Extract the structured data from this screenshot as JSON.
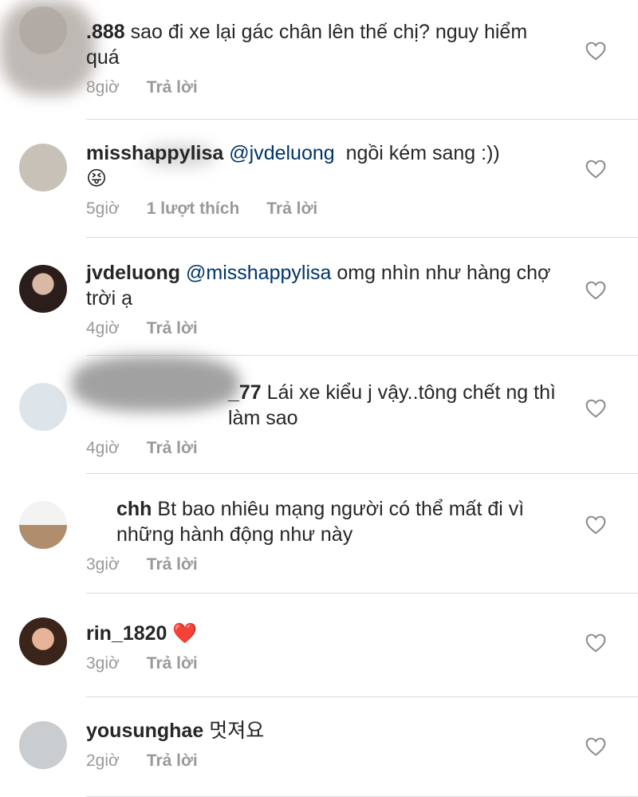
{
  "comments": [
    {
      "username": ".888",
      "text": "sao đi xe lại gác chân lên thế chị? nguy hiểm quá",
      "time": "8giờ",
      "reply": "Trả lời"
    },
    {
      "username": "misshappylisa",
      "mention": "@jvdeluong",
      "text": "  ngồi kém sang :))",
      "emoji": "😝",
      "time": "5giờ",
      "likes": "1 lượt thích",
      "reply": "Trả lời"
    },
    {
      "username": "jvdeluong",
      "mention": "@misshappylisa",
      "text": " omg nhìn như hàng chợ trời ạ",
      "time": "4giờ",
      "reply": "Trả lời"
    },
    {
      "username": "_77",
      "text": "Lái xe kiểu j vậy..tông chết ng thì làm sao",
      "time": "4giờ",
      "reply": "Trả lời"
    },
    {
      "username": "chh",
      "text": "Bt bao nhiêu mạng người có thể mất đi vì những hành động như này",
      "time": "3giờ",
      "reply": "Trả lời"
    },
    {
      "username": "rin_1820",
      "text": "",
      "emoji": "❤️",
      "time": "3giờ",
      "reply": "Trả lời"
    },
    {
      "username": "yousunghae",
      "text": "멋져요",
      "time": "2giờ",
      "reply": "Trả lời"
    }
  ],
  "colors": {
    "username": "#262626",
    "mention": "#003569",
    "meta": "#999999",
    "separator": "#dbdbdb"
  },
  "icons": {
    "like": "heart-outline-icon"
  }
}
